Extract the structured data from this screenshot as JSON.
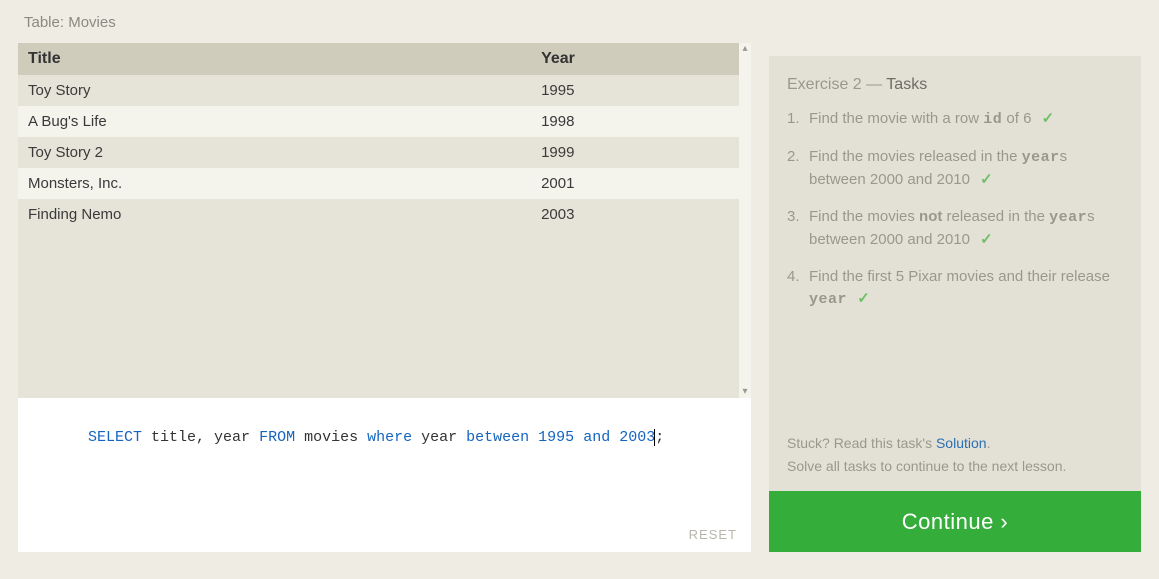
{
  "table": {
    "label": "Table: Movies",
    "columns": [
      "Title",
      "Year"
    ],
    "rows": [
      {
        "title": "Toy Story",
        "year": "1995"
      },
      {
        "title": "A Bug's Life",
        "year": "1998"
      },
      {
        "title": "Toy Story 2",
        "year": "1999"
      },
      {
        "title": "Monsters, Inc.",
        "year": "2001"
      },
      {
        "title": "Finding Nemo",
        "year": "2003"
      }
    ]
  },
  "sql": {
    "tokens": [
      {
        "t": "SELECT",
        "c": "kw"
      },
      {
        "t": " title, year ",
        "c": ""
      },
      {
        "t": "FROM",
        "c": "kw"
      },
      {
        "t": " movies ",
        "c": ""
      },
      {
        "t": "where",
        "c": "kw"
      },
      {
        "t": " year ",
        "c": ""
      },
      {
        "t": "between",
        "c": "kw"
      },
      {
        "t": " ",
        "c": ""
      },
      {
        "t": "1995",
        "c": "num"
      },
      {
        "t": " ",
        "c": ""
      },
      {
        "t": "and",
        "c": "kw"
      },
      {
        "t": " ",
        "c": ""
      },
      {
        "t": "2003",
        "c": "num"
      },
      {
        "t": ";",
        "c": "",
        "caretBefore": true
      }
    ],
    "reset_label": "RESET"
  },
  "tasks": {
    "heading_light": "Exercise 2 — ",
    "heading_strong": "Tasks",
    "items": [
      {
        "n": "1.",
        "html": "Find the movie with a row <code>id</code> of 6",
        "done": true
      },
      {
        "n": "2.",
        "html": "Find the movies released in the <code>year</code>s between 2000 and 2010",
        "done": true
      },
      {
        "n": "3.",
        "html": "Find the movies <b>not</b> released in the <code>year</code>s between 2000 and 2010",
        "done": true
      },
      {
        "n": "4.",
        "html": "Find the first 5 Pixar movies and their release <code>year</code>",
        "done": true
      }
    ],
    "hint_prefix": "Stuck? Read this task's ",
    "hint_link": "Solution",
    "hint_suffix": ".",
    "hint_line2": "Solve all tasks to continue to the next lesson.",
    "continue_label": "Continue ›"
  }
}
